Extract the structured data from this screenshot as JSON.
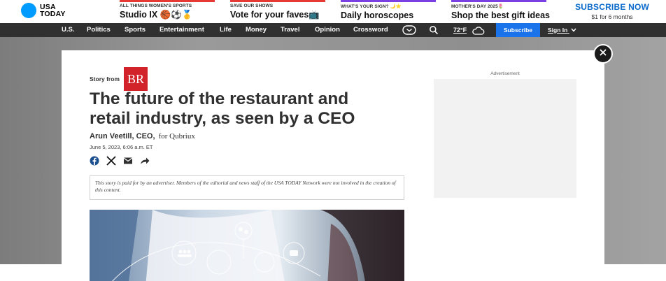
{
  "brand": {
    "name_line1": "USA",
    "name_line2": "TODAY",
    "color": "#009bff"
  },
  "promos": [
    {
      "eyebrow": "ALL THINGS WOMEN'S SPORTS",
      "headline": "Studio IX 🏀⚽🥇",
      "accent": "#e53935"
    },
    {
      "eyebrow": "SAVE OUR SHOWS",
      "headline": "Vote for your faves📺",
      "accent": "#e53935"
    },
    {
      "eyebrow": "WHAT'S YOUR SIGN? 🌙⭐",
      "headline": "Daily horoscopes",
      "accent": "#7b3fe4"
    },
    {
      "eyebrow": "MOTHER'S DAY 2025🌷",
      "headline": "Shop the best gift ideas",
      "accent": "#7b3fe4"
    }
  ],
  "subscribe_promo": {
    "title": "SUBSCRIBE NOW",
    "subtitle": "$1 for 6 months"
  },
  "nav": {
    "items": [
      "U.S.",
      "Politics",
      "Sports",
      "Entertainment",
      "Life",
      "Money",
      "Travel",
      "Opinion",
      "Crossword"
    ],
    "weather": "72°F",
    "subscribe": "Subscribe",
    "sign_in": "Sign In"
  },
  "modal": {
    "story_from": "Story from",
    "sponsor_badge": "BR",
    "title": "The future of the restaurant and retail industry, as seen by a CEO",
    "author": "Arun Veetill, CEO,",
    "author_for": "for Qubriux",
    "date": "June 5, 2023, 6:06 a.m. ET",
    "share_icons": [
      "facebook-icon",
      "x-icon",
      "email-icon",
      "share-arrow-icon"
    ],
    "disclaimer": "This story is paid for by an advertiser. Members of the editorial and news staff of the USA TODAY Network were not involved in the creation of this content.",
    "advertisement_label": "Advertisement"
  }
}
